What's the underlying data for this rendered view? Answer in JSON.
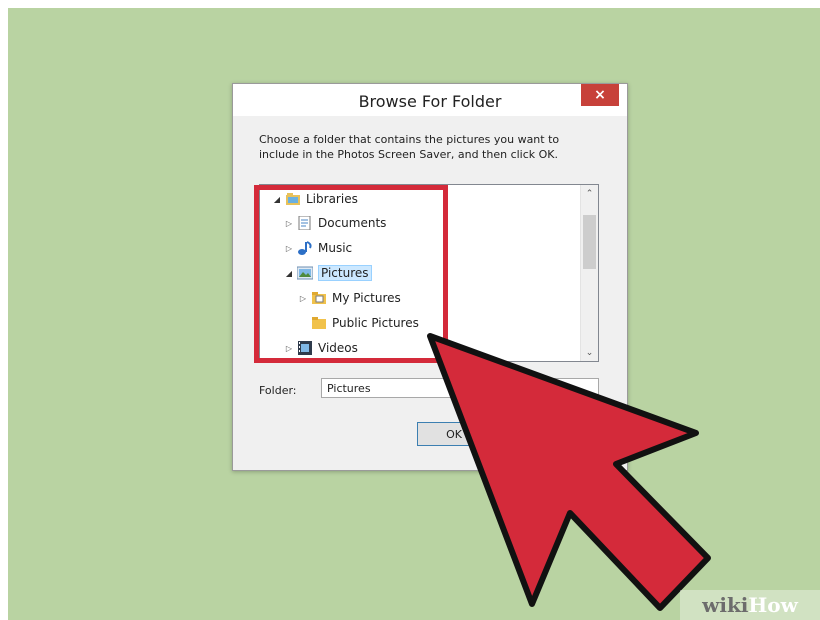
{
  "dialog": {
    "title": "Browse For Folder",
    "close_label": "×",
    "description": "Choose a folder that contains the pictures you want to include in the Photos Screen Saver, and then click OK.",
    "folder_label": "Folder:",
    "folder_value": "Pictures",
    "ok_label": "OK"
  },
  "tree": {
    "items": [
      {
        "label": "Libraries",
        "icon": "libraries-icon",
        "expanded": true
      },
      {
        "label": "Documents",
        "icon": "documents-icon",
        "expanded": false
      },
      {
        "label": "Music",
        "icon": "music-icon",
        "expanded": false
      },
      {
        "label": "Pictures",
        "icon": "pictures-icon",
        "expanded": true,
        "selected": true
      },
      {
        "label": "My Pictures",
        "icon": "folder-icon",
        "expanded": false
      },
      {
        "label": "Public Pictures",
        "icon": "folder-icon"
      },
      {
        "label": "Videos",
        "icon": "videos-icon",
        "expanded": false
      }
    ]
  },
  "overlay": {
    "highlight_color": "#d42a3a",
    "cursor_color": "#d42a3a"
  },
  "watermark": {
    "part1": "wiki",
    "part2": "How"
  }
}
